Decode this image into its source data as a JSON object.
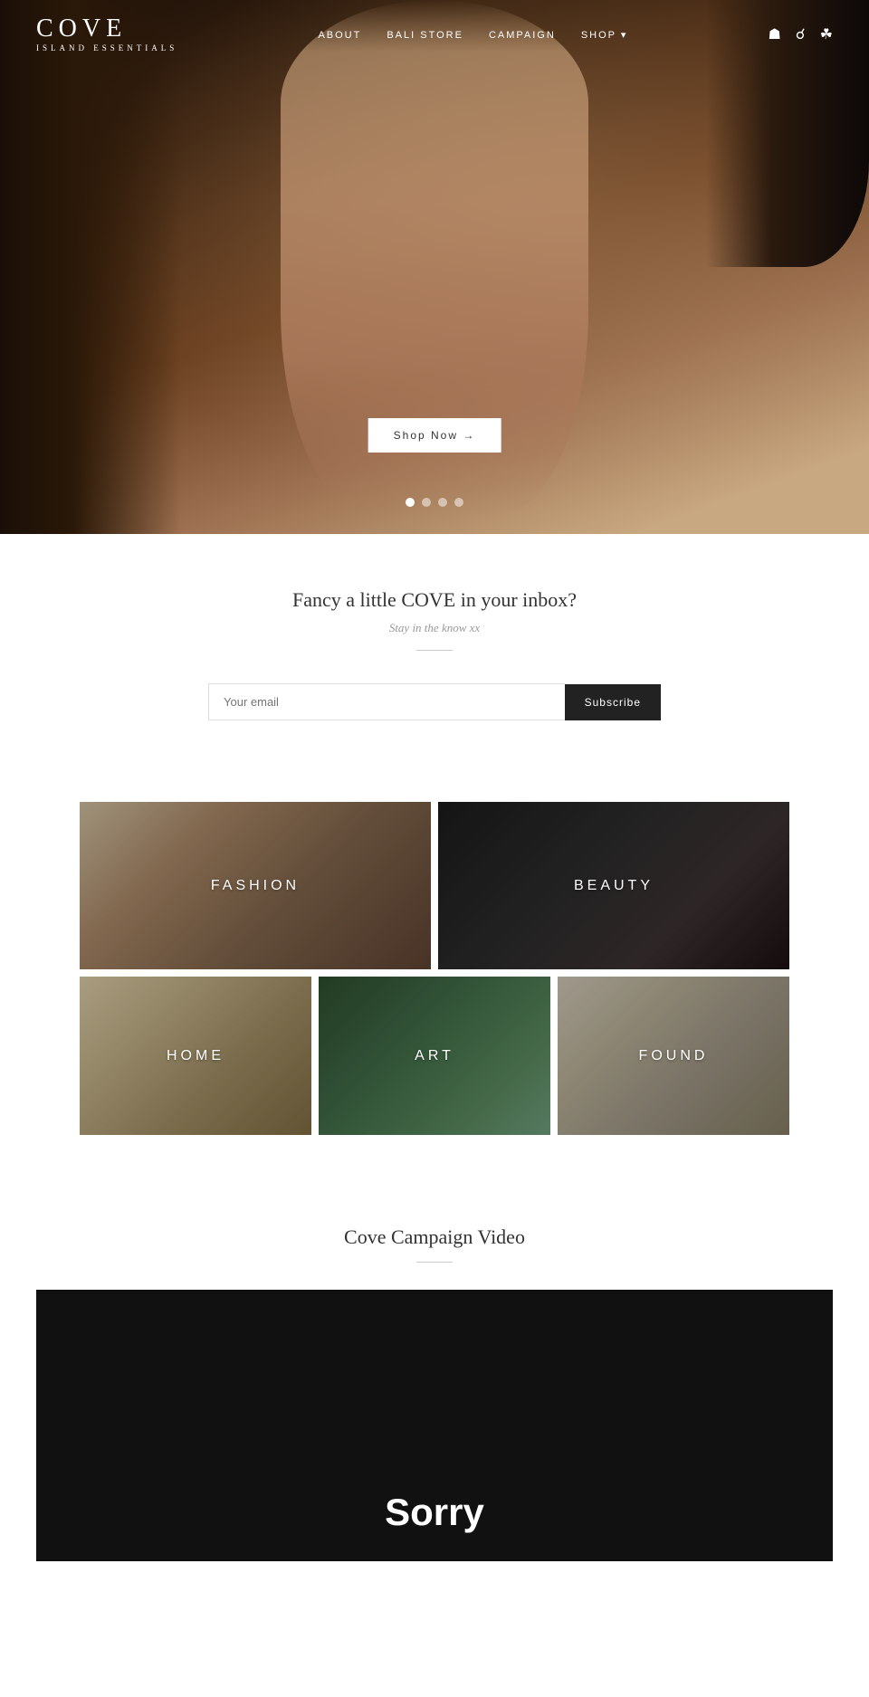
{
  "site": {
    "logo_title": "COVE",
    "logo_subtitle": "ISLAND ESSENTIALS"
  },
  "nav": {
    "links": [
      {
        "label": "ABOUT",
        "name": "about-link"
      },
      {
        "label": "BALI STORE",
        "name": "bali-store-link"
      },
      {
        "label": "CAMPAIGN",
        "name": "campaign-link"
      },
      {
        "label": "SHOP ▾",
        "name": "shop-link"
      }
    ],
    "icons": {
      "user": "👤",
      "search": "🔍",
      "cart": "🛒"
    }
  },
  "hero": {
    "cta_label": "Shop Now →",
    "dots": [
      true,
      false,
      false,
      false
    ]
  },
  "newsletter": {
    "heading": "Fancy a little COVE in your inbox?",
    "subheading": "Stay in the know xx",
    "input_placeholder": "Your email",
    "button_label": "Subscribe"
  },
  "categories": {
    "top": [
      {
        "label": "FASHION",
        "name": "fashion"
      },
      {
        "label": "BEAUTY",
        "name": "beauty"
      }
    ],
    "bottom": [
      {
        "label": "HOME",
        "name": "home"
      },
      {
        "label": "ART",
        "name": "art"
      },
      {
        "label": "FOUND",
        "name": "found"
      }
    ]
  },
  "video_section": {
    "heading": "Cove Campaign Video",
    "sorry_text": "Sorry"
  }
}
